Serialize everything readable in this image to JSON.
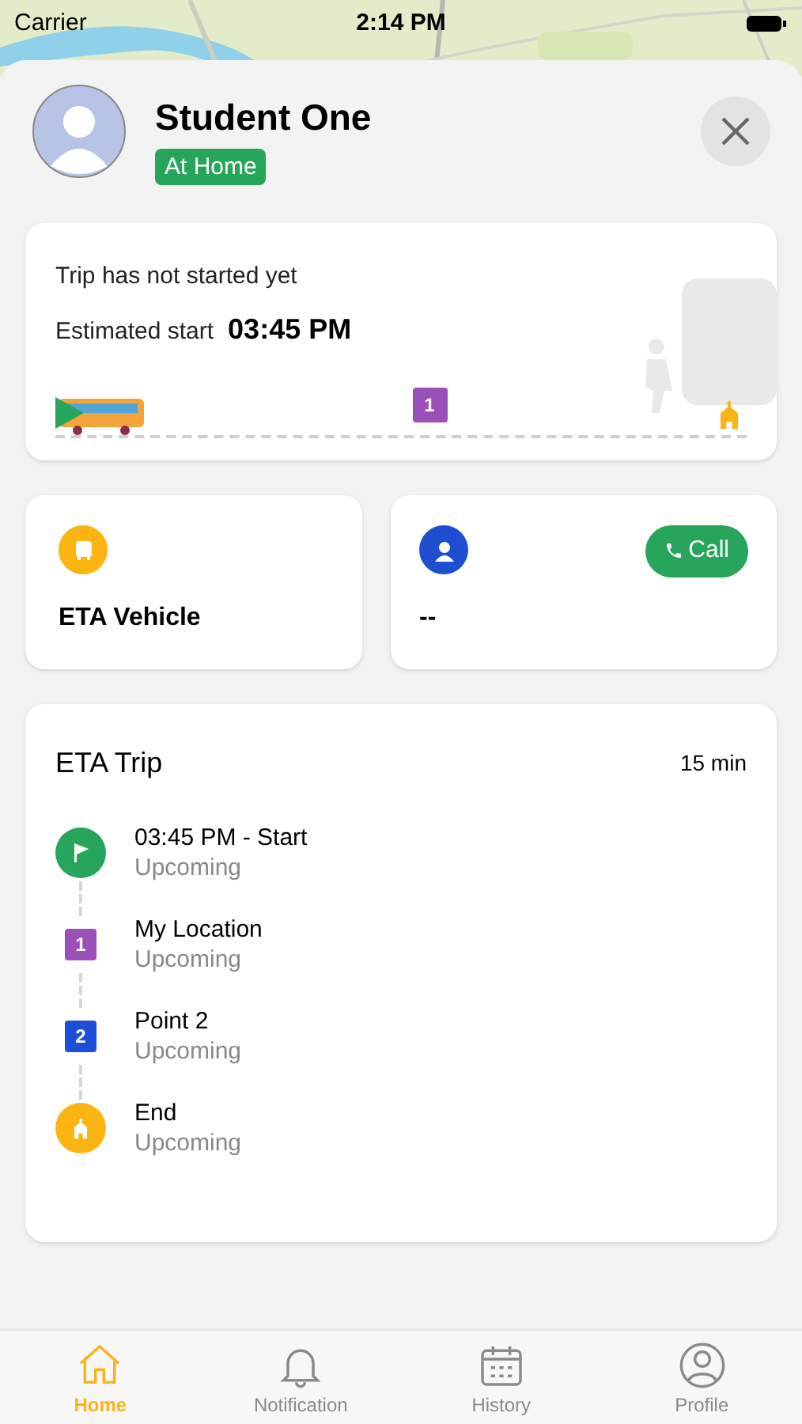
{
  "status_bar": {
    "carrier": "Carrier",
    "time": "2:14 PM"
  },
  "student": {
    "name": "Student One",
    "status": "At Home"
  },
  "trip_status": {
    "message": "Trip has not started yet",
    "estimate_label": "Estimated start",
    "estimate_time": "03:45 PM",
    "markers": [
      {
        "number": "1",
        "color": "#9b4fb8"
      }
    ]
  },
  "vehicle_card": {
    "label": "ETA Vehicle"
  },
  "driver_card": {
    "value": "--",
    "call_button": "Call"
  },
  "eta_trip": {
    "title": "ETA Trip",
    "duration": "15 min",
    "stops": [
      {
        "kind": "start",
        "title": "03:45 PM - Start",
        "status": "Upcoming"
      },
      {
        "kind": "point",
        "number": "1",
        "color": "#9b4fb8",
        "title": "My Location",
        "status": "Upcoming"
      },
      {
        "kind": "point",
        "number": "2",
        "color": "#1d4ed8",
        "title": "Point 2",
        "status": "Upcoming"
      },
      {
        "kind": "end",
        "title": "End",
        "status": "Upcoming"
      }
    ]
  },
  "tabs": [
    {
      "label": "Home",
      "selected": true
    },
    {
      "label": "Notification",
      "selected": false
    },
    {
      "label": "History",
      "selected": false
    },
    {
      "label": "Profile",
      "selected": false
    }
  ]
}
